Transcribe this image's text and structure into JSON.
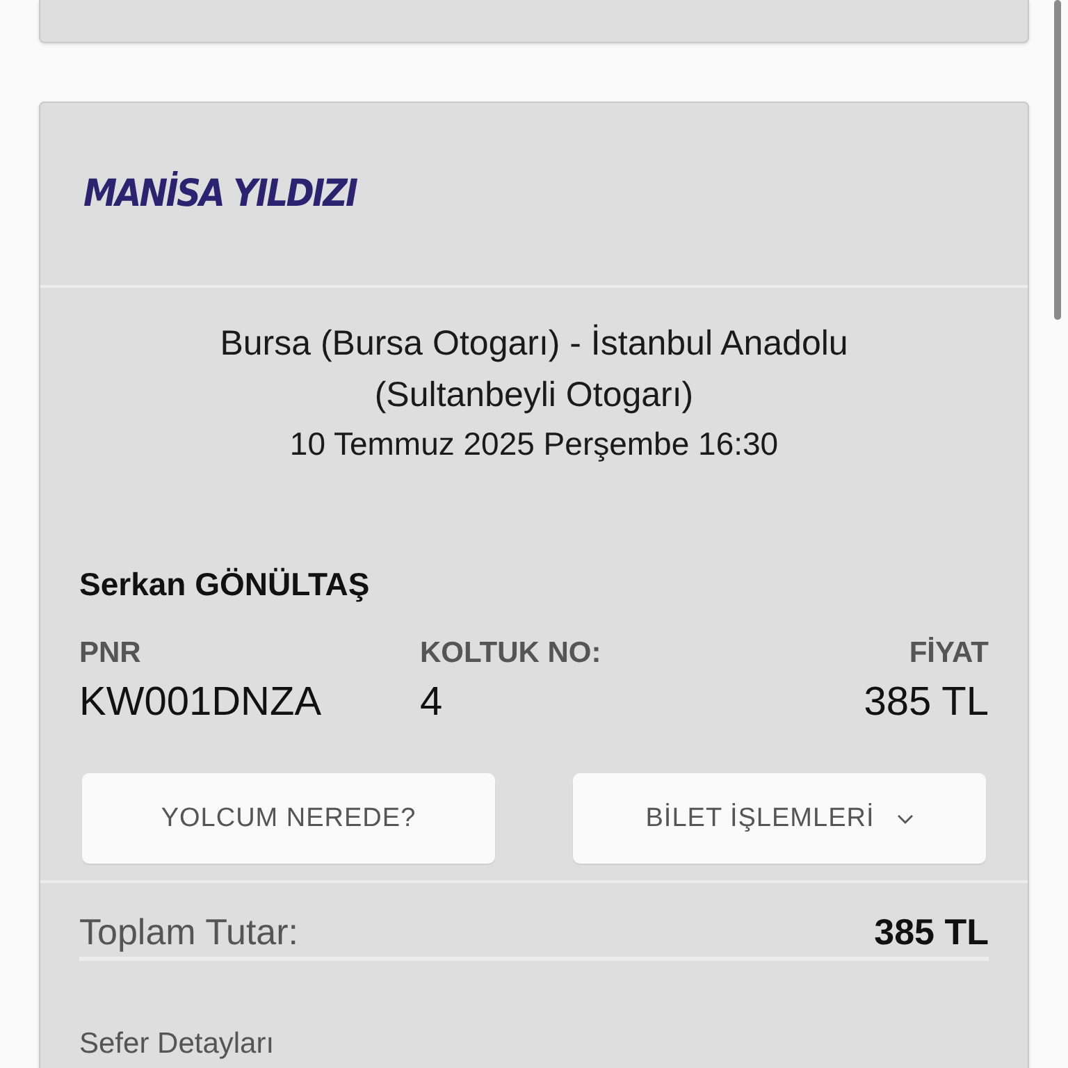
{
  "operator": {
    "logo": "MANİSA YILDIZI"
  },
  "route": {
    "line": "Bursa (Bursa Otogarı) - İstanbul Anadolu (Sultanbeyli Otogarı)",
    "datetime": "10 Temmuz 2025 Perşembe 16:30"
  },
  "passenger": {
    "name": "Serkan GÖNÜLTAŞ"
  },
  "fields": [
    {
      "label": "PNR",
      "value": "KW001DNZA"
    },
    {
      "label": "KOLTUK NO:",
      "value": "4"
    },
    {
      "label": "FİYAT",
      "value": "385 TL"
    }
  ],
  "buttons": [
    {
      "label": "YOLCUM NEREDE?",
      "kind": "plain"
    },
    {
      "label": "BİLET İŞLEMLERİ",
      "kind": "dropdown"
    }
  ],
  "total": {
    "label": "Toplam Tutar:",
    "value": "385 TL"
  },
  "details_link": "Sefer Detayları"
}
